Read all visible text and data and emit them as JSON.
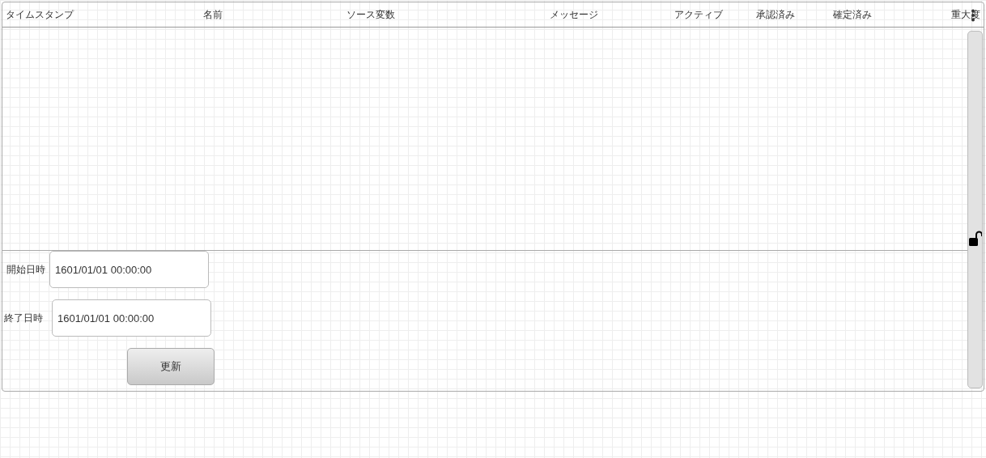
{
  "table": {
    "columns": [
      {
        "label": "タイムスタンプ"
      },
      {
        "label": "名前"
      },
      {
        "label": "ソース変数"
      },
      {
        "label": "メッセージ"
      },
      {
        "label": "アクティブ"
      },
      {
        "label": "承認済み"
      },
      {
        "label": "確定済み"
      },
      {
        "label": "重大度"
      }
    ]
  },
  "filter": {
    "fields": [
      {
        "label": "開始日時",
        "value": "1601/01/01 00:00:00"
      },
      {
        "label": "終了日時",
        "value": "1601/01/01 00:00:00"
      }
    ],
    "button": "更新"
  }
}
